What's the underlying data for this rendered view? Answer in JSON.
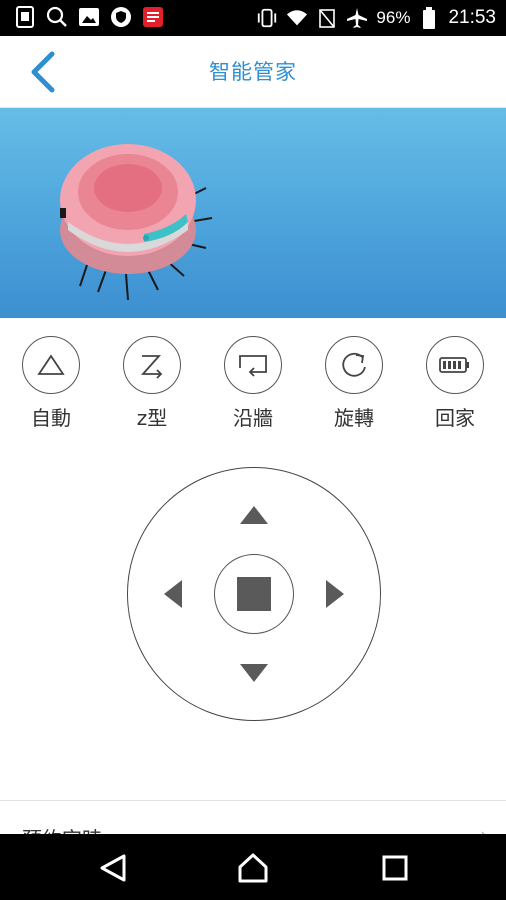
{
  "status_bar": {
    "left_icons": [
      "sim-icon",
      "search-icon",
      "image-icon",
      "shield-icon",
      "app-notification-icon"
    ],
    "battery_percent": "96%",
    "time": "21:53"
  },
  "app_bar": {
    "title": "智能管家",
    "back_icon": "chevron-left-icon"
  },
  "modes": [
    {
      "label": "自動",
      "icon": "triangle-icon"
    },
    {
      "label": "z型",
      "icon": "zigzag-icon"
    },
    {
      "label": "沿牆",
      "icon": "wall-follow-icon"
    },
    {
      "label": "旋轉",
      "icon": "rotate-icon"
    },
    {
      "label": "回家",
      "icon": "battery-icon"
    }
  ],
  "direction_pad": {
    "up": "arrow-up-icon",
    "down": "arrow-down-icon",
    "left": "arrow-left-icon",
    "right": "arrow-right-icon",
    "center": "stop-icon"
  },
  "list": {
    "first_item_label": "預約定時",
    "first_item_arrow": "›"
  },
  "colors": {
    "accent": "#2f8fd0",
    "banner_top": "#66bde6",
    "banner_bottom": "#3d8fd0",
    "robot_body": "#f2a5b1"
  }
}
